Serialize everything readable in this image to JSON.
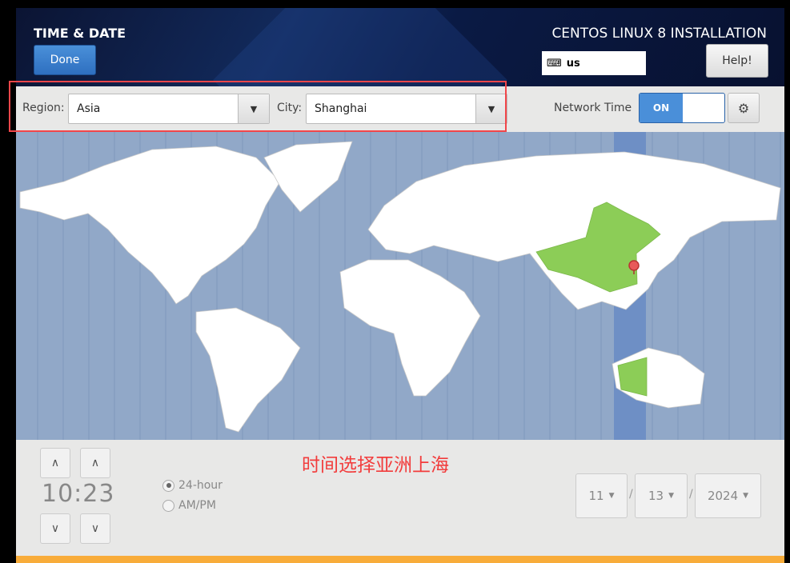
{
  "header": {
    "title": "TIME & DATE",
    "done_label": "Done",
    "product": "CENTOS LINUX 8 INSTALLATION",
    "keyboard_layout": "us",
    "help_label": "Help!"
  },
  "toolbar": {
    "region_label": "Region:",
    "region_value": "Asia",
    "city_label": "City:",
    "city_value": "Shanghai",
    "network_time_label": "Network Time",
    "network_time_state": "ON"
  },
  "time": {
    "value": "10:23",
    "formats": [
      {
        "label": "24-hour",
        "selected": true
      },
      {
        "label": "AM/PM",
        "selected": false
      }
    ]
  },
  "date": {
    "month": "11",
    "day": "13",
    "year": "2024",
    "separator": "/"
  },
  "annotation": "时间选择亚洲上海",
  "colors": {
    "accent": "#4a8fd9",
    "selected_zone": "#6e8fc5",
    "ocean": "#91a8c8",
    "selected_country": "#8ccd57",
    "annotation": "#f23c3c",
    "progress": "#f8ac3a"
  }
}
